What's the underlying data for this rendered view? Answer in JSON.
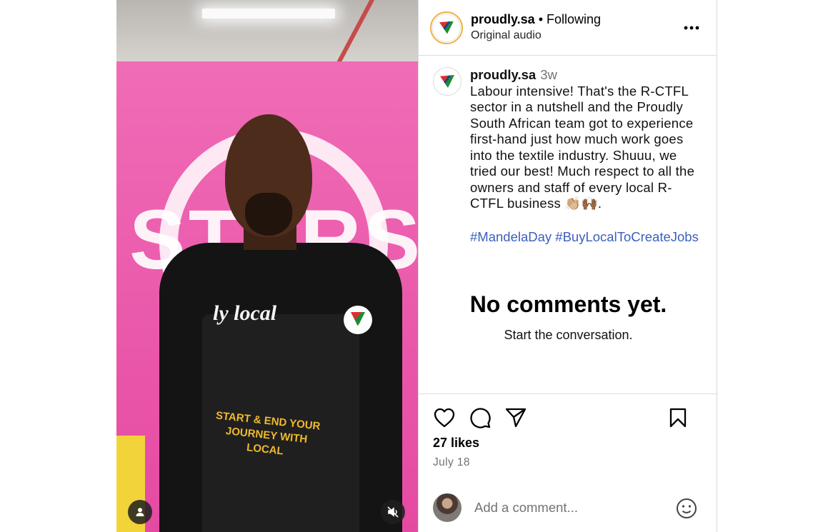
{
  "header": {
    "username": "proudly.sa",
    "separator": "•",
    "follow_status": "Following",
    "audio": "Original audio",
    "more_icon": "more-horizontal-icon"
  },
  "media": {
    "shirt_text": "ly local",
    "apron_text": "START & END YOUR JOURNEY WITH LOCAL",
    "banner_text": "STARS",
    "user_icon": "user-icon",
    "mute_icon": "muted-speaker-icon"
  },
  "caption": {
    "username": "proudly.sa",
    "time": "3w",
    "text": "Labour intensive! That's the R-CTFL sector in a nutshell and the Proudly South African team got to experience first-hand just how much work goes into the textile industry. Shuuu, we tried our best! Much respect to all the owners and staff of every local R-CTFL business 👏🏼🙌🏾.",
    "hashtags": [
      "#MandelaDay",
      "#BuyLocalToCreateJobs"
    ]
  },
  "comments": {
    "empty_title": "No comments yet.",
    "empty_subtitle": "Start the conversation."
  },
  "actions": {
    "like_icon": "heart-icon",
    "comment_icon": "comment-icon",
    "share_icon": "send-icon",
    "save_icon": "bookmark-icon",
    "likes": "27 likes",
    "date": "July 18"
  },
  "add_comment": {
    "placeholder": "Add a comment...",
    "emoji_icon": "emoji-icon"
  },
  "colors": {
    "hashtag": "#3a5fbe",
    "muted_text": "#737373",
    "border": "#dbdbdb",
    "story_ring": "#f1b241"
  }
}
